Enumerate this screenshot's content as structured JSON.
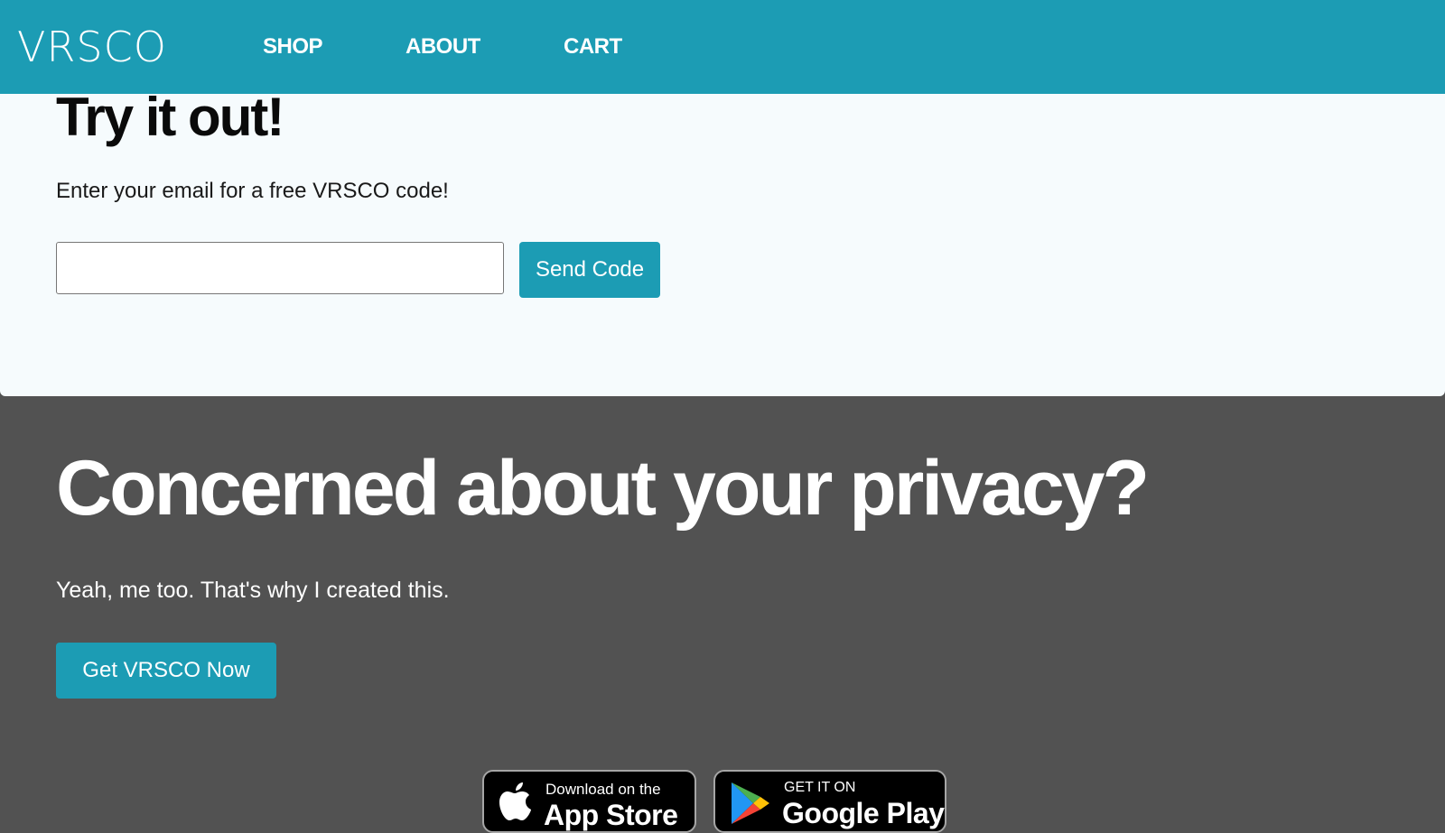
{
  "nav": {
    "logo": "VRSCO",
    "links": [
      "SHOP",
      "ABOUT",
      "CART"
    ]
  },
  "try_section": {
    "title": "Try it out!",
    "subtitle": "Enter your email for a free VRSCO code!",
    "email_value": "",
    "email_placeholder": "",
    "send_button": "Send Code"
  },
  "privacy_section": {
    "title": "Concerned about your privacy?",
    "subtitle": "Yeah, me too. That's why I created this.",
    "cta_button": "Get VRSCO Now"
  },
  "badges": {
    "apple": {
      "small": "Download on the",
      "big": "App Store",
      "icon": "apple-icon"
    },
    "google": {
      "small": "GET IT ON",
      "big": "Google Play",
      "icon": "google-play-icon"
    }
  },
  "colors": {
    "accent": "#1c9cb4",
    "dark_bg": "#525252",
    "light_bg": "#f6fbfd"
  }
}
